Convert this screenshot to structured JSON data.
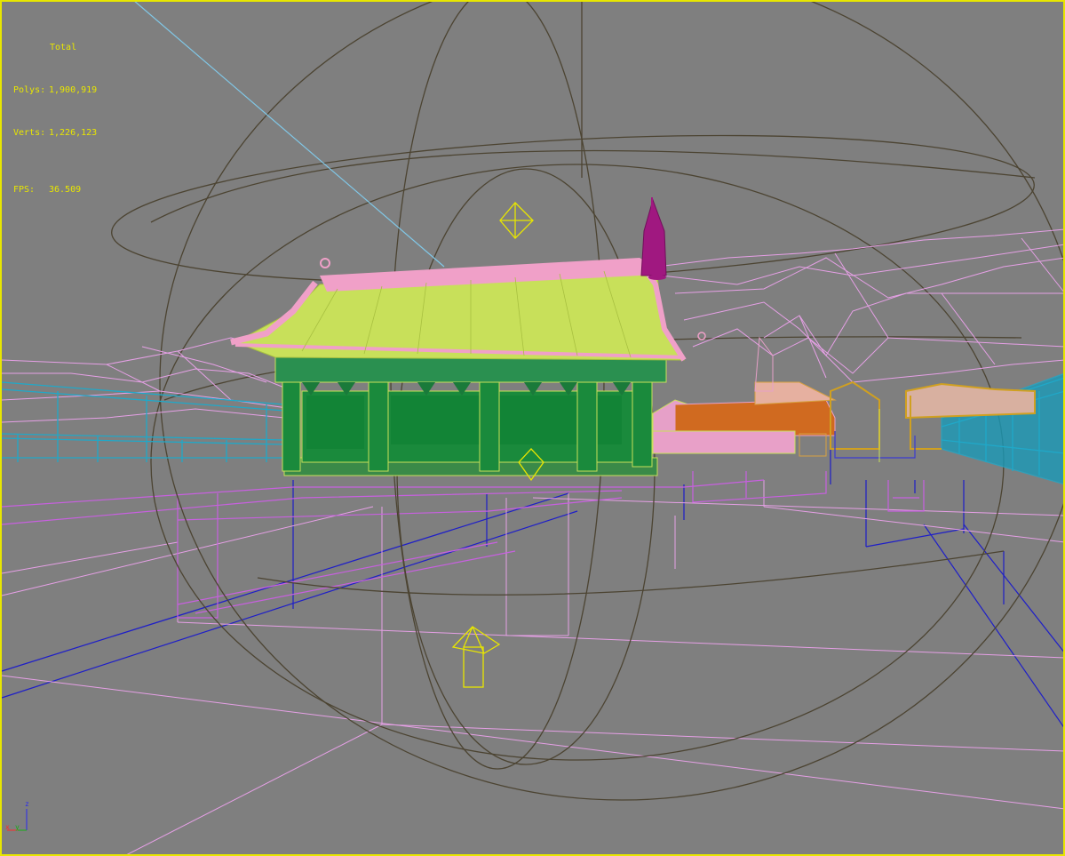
{
  "stats": {
    "title": "Total",
    "polys_label": "Polys:",
    "polys_value": "1,900,919",
    "verts_label": "Verts:",
    "verts_value": "1,226,123",
    "fps_label": "FPS:",
    "fps_value": "36.509"
  },
  "axis_gizmo": {
    "z": "z",
    "x": "x",
    "y": "y"
  },
  "colors": {
    "viewport_bg": "#7f7f7f",
    "active_border": "#e8e600",
    "stats_text": "#e8e600",
    "roof": "#c8e05a",
    "roof_edge": "#f0a0c8",
    "pavilion_body": "#1a8a3a",
    "spire": "#a01880",
    "terrain_wire": "#e8a0e8",
    "platform_wire": "#c060e0",
    "ground_lines": "#2020c0",
    "railing": "#20a0c0",
    "skydome": "#4a4030",
    "helpers": "#e8e600",
    "orange_roof": "#d06020"
  }
}
